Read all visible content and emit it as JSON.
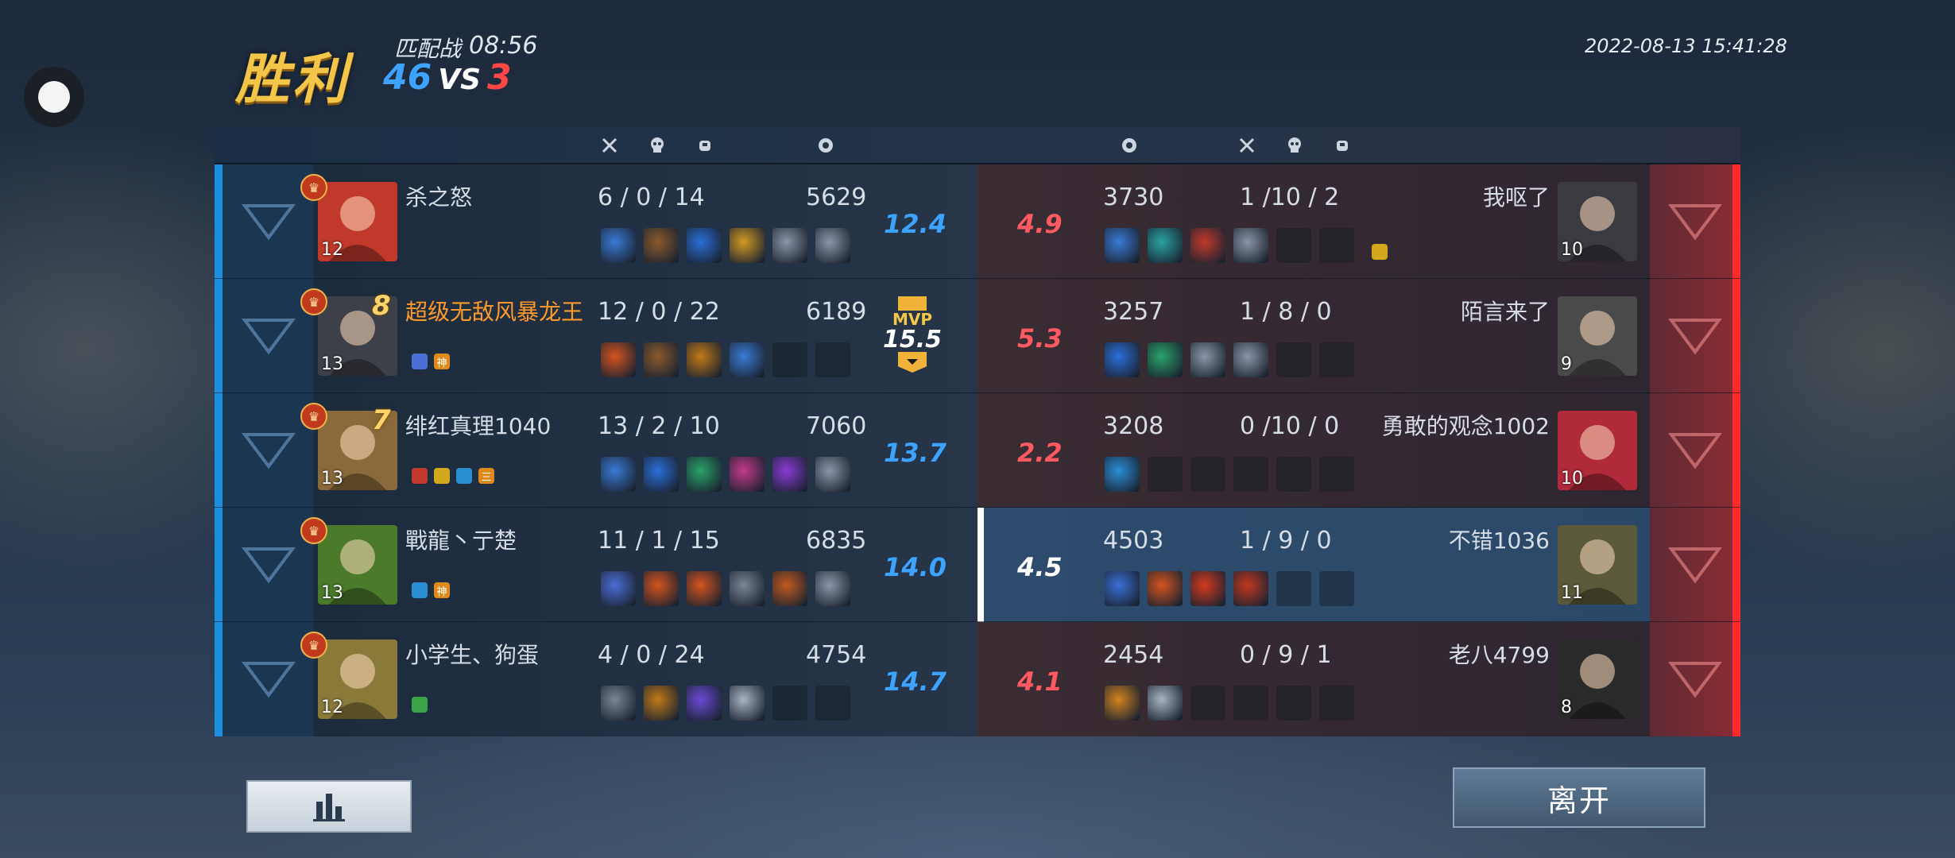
{
  "header": {
    "result": "胜利",
    "mode": "匹配战",
    "duration": "08:56",
    "score_blue": "46",
    "vs": "VS",
    "score_red": "3",
    "datetime": "2022-08-13 15:41:28"
  },
  "columns": {
    "kills_icon": "crossed-swords-icon",
    "deaths_icon": "skull-icon",
    "assists_icon": "fist-icon",
    "gold_icon": "coin-icon"
  },
  "mvp_label": "MVP",
  "blue_team": [
    {
      "name": "杀之怒",
      "level": "12",
      "kda": "6 / 0 / 14",
      "gold": "5629",
      "rating": "12.4",
      "tags": [],
      "mark": "",
      "items": [
        "#3a7bd5",
        "#8a5a2b",
        "#2a6fd8",
        "#d49a22",
        "#8a96a8",
        "#8a96a8"
      ],
      "portrait": "#c0392b"
    },
    {
      "name": "超级无敌风暴龙王",
      "level": "13",
      "kda": "12 / 0 / 22",
      "gold": "6189",
      "rating": "15.5",
      "mvp": true,
      "tags": [
        {
          "t": "",
          "c": "#4a6fd6"
        },
        {
          "t": "神",
          "c": "#e08a1e"
        }
      ],
      "mark": "8",
      "items": [
        "#d4541e",
        "#8a5a2b",
        "#c27a18",
        "#3a7bd5",
        "",
        ""
      ],
      "portrait": "#3d4048"
    },
    {
      "name": "绯红真理1040",
      "level": "13",
      "kda": "13 / 2 / 10",
      "gold": "7060",
      "rating": "13.7",
      "tags": [
        {
          "t": "",
          "c": "#c0392b"
        },
        {
          "t": "",
          "c": "#d4a81e"
        },
        {
          "t": "",
          "c": "#2a8fd0"
        },
        {
          "t": "三",
          "c": "#e08a1e"
        }
      ],
      "mark": "7",
      "items": [
        "#3a7bd5",
        "#2a6fd8",
        "#2aa36a",
        "#c23a8a",
        "#8a3ad4",
        "#8a96a8"
      ],
      "portrait": "#8a6a3a"
    },
    {
      "name": "戰龍丶亍楚",
      "level": "13",
      "kda": "11 / 1 / 15",
      "gold": "6835",
      "rating": "14.0",
      "tags": [
        {
          "t": "",
          "c": "#2a8fd0"
        },
        {
          "t": "神",
          "c": "#e08a1e"
        }
      ],
      "mark": "",
      "items": [
        "#4a6fd6",
        "#d4541e",
        "#d4541e",
        "#7a8696",
        "#c25a1e",
        "#8a96a8"
      ],
      "portrait": "#4a7a2a"
    },
    {
      "name": "小学生、狗蛋",
      "level": "12",
      "kda": "4 / 0 / 24",
      "gold": "4754",
      "rating": "14.7",
      "tags": [
        {
          "t": "",
          "c": "#3aa34a"
        }
      ],
      "mark": "",
      "items": [
        "#7a8696",
        "#c27a18",
        "#6a4ad6",
        "#a8b4c4",
        "",
        ""
      ],
      "portrait": "#8a7a3a"
    }
  ],
  "red_team": [
    {
      "name": "我呕了",
      "level": "10",
      "kda": "1 /10 / 2",
      "gold": "3730",
      "rating": "4.9",
      "items": [
        "#3a7bd5",
        "#2aa3a3",
        "#c0392b",
        "#8a96a8",
        "",
        ""
      ],
      "portrait": "#3a3a40",
      "extra_icon": true
    },
    {
      "name": "陌言来了",
      "level": "9",
      "kda": "1 / 8 / 0",
      "gold": "3257",
      "rating": "5.3",
      "items": [
        "#2a6fd8",
        "#2aa36a",
        "#8a96a8",
        "#8a96a8",
        "",
        ""
      ],
      "portrait": "#4a4a4a"
    },
    {
      "name": "勇敢的观念1002",
      "level": "10",
      "kda": "0 /10 / 0",
      "gold": "3208",
      "rating": "2.2",
      "items": [
        "#2a8fd8",
        "",
        "",
        "",
        "",
        ""
      ],
      "portrait": "#b02a3a"
    },
    {
      "name": "不错1036",
      "level": "11",
      "kda": "1 / 9 / 0",
      "gold": "4503",
      "rating": "4.5",
      "items": [
        "#3a6fd6",
        "#d4541e",
        "#d43a1e",
        "#c2381e",
        "",
        ""
      ],
      "portrait": "#5a5a3a",
      "highlight": true
    },
    {
      "name": "老八4799",
      "level": "8",
      "kda": "0 / 9 / 1",
      "gold": "2454",
      "rating": "4.1",
      "items": [
        "#d4841e",
        "#a8b4c4",
        "",
        "",
        "",
        ""
      ],
      "portrait": "#2a2a2a"
    }
  ],
  "buttons": {
    "leave": "离开",
    "stats_icon": "bar-chart-icon"
  },
  "colors": {
    "blue": "#3ea2ff",
    "red": "#ff4747",
    "gold": "#f3c64a"
  }
}
